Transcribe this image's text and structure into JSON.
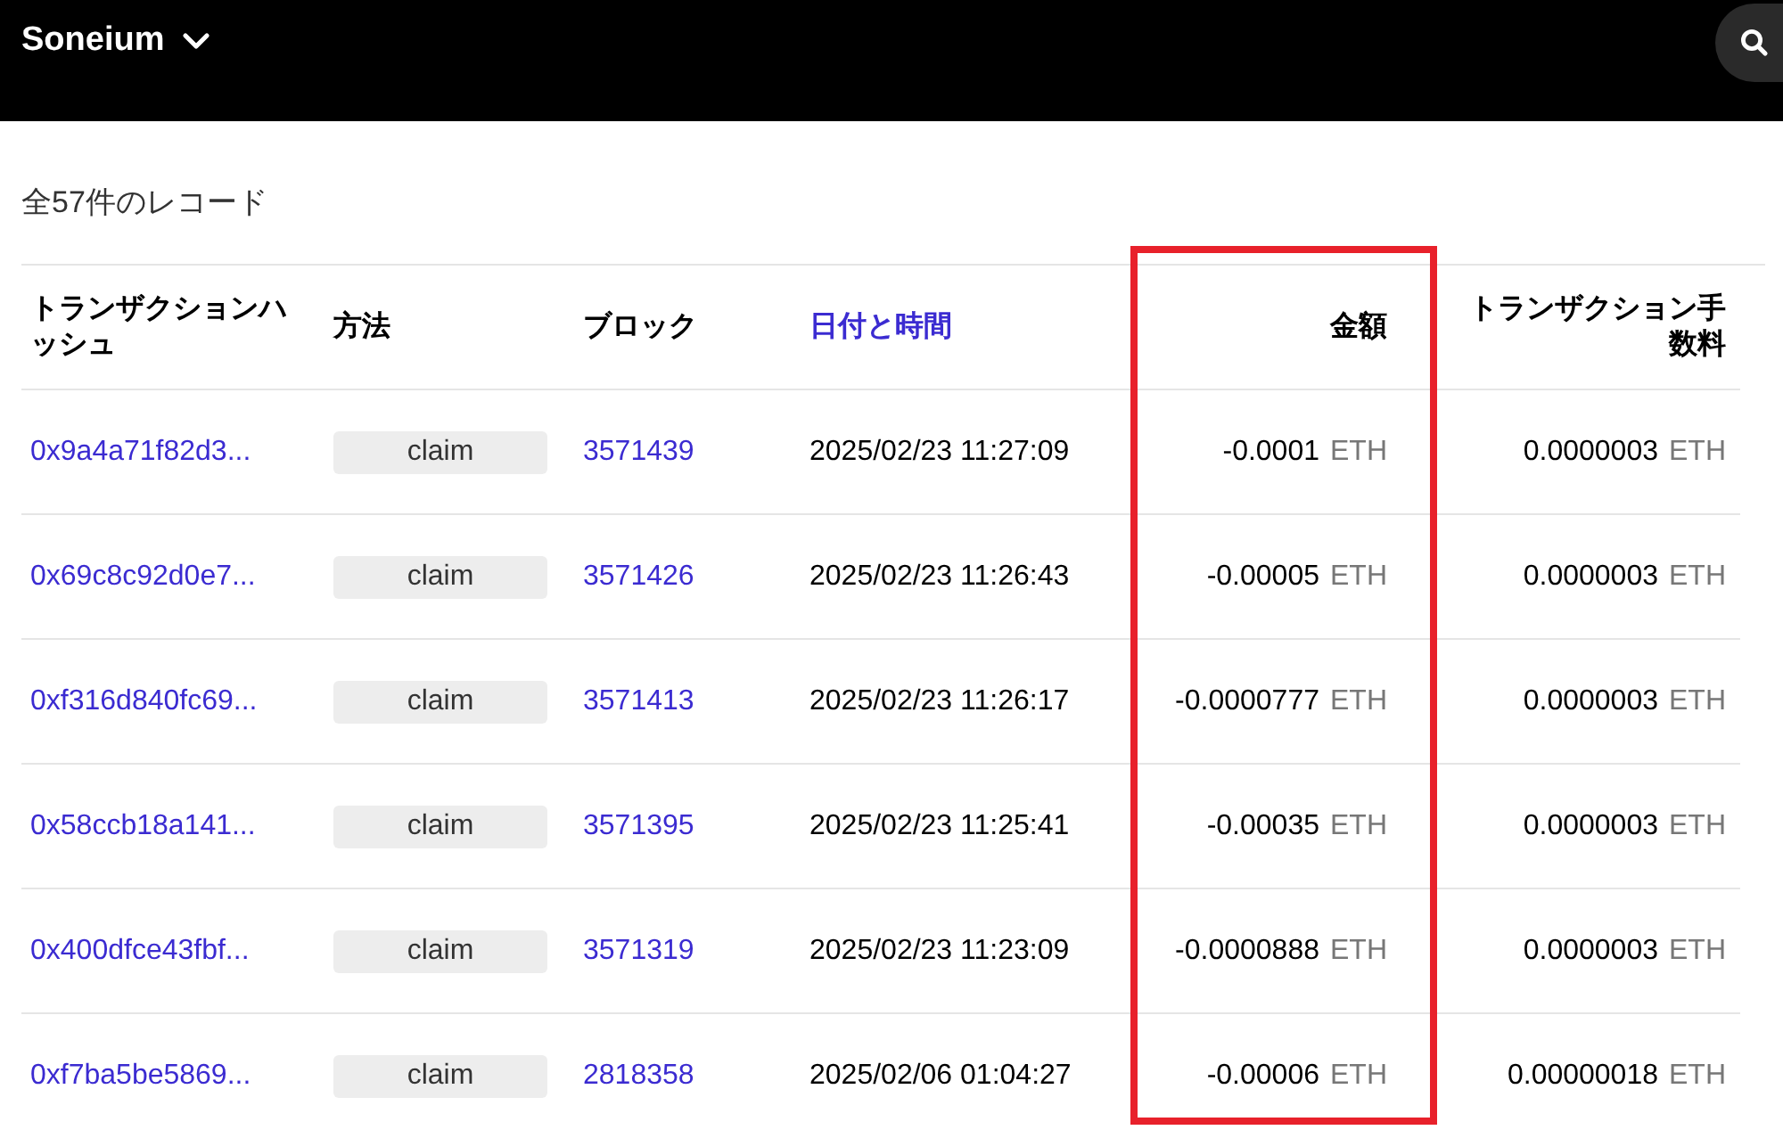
{
  "header": {
    "network": "Soneium"
  },
  "record_count": "全57件のレコード",
  "table": {
    "columns": [
      {
        "label": "トランザクションハッシュ",
        "kind": "plain",
        "highlighted": false
      },
      {
        "label": "方法",
        "kind": "plain",
        "highlighted": false
      },
      {
        "label": "ブロック",
        "kind": "plain",
        "highlighted": false
      },
      {
        "label": "日付と時間",
        "kind": "link",
        "highlighted": false
      },
      {
        "label": "金額",
        "kind": "plain",
        "highlighted": true
      },
      {
        "label": "トランザクション手数料",
        "kind": "plain",
        "highlighted": false
      }
    ],
    "rows": [
      {
        "hash": "0x9a4a71f82d3...",
        "method": "claim",
        "block": "3571439",
        "time": "2025/02/23 11:27:09",
        "amount": "-0.0001",
        "amount_unit": "ETH",
        "fee": "0.0000003",
        "fee_unit": "ETH"
      },
      {
        "hash": "0x69c8c92d0e7...",
        "method": "claim",
        "block": "3571426",
        "time": "2025/02/23 11:26:43",
        "amount": "-0.00005",
        "amount_unit": "ETH",
        "fee": "0.0000003",
        "fee_unit": "ETH"
      },
      {
        "hash": "0xf316d840fc69...",
        "method": "claim",
        "block": "3571413",
        "time": "2025/02/23 11:26:17",
        "amount": "-0.0000777",
        "amount_unit": "ETH",
        "fee": "0.0000003",
        "fee_unit": "ETH"
      },
      {
        "hash": "0x58ccb18a141...",
        "method": "claim",
        "block": "3571395",
        "time": "2025/02/23 11:25:41",
        "amount": "-0.00035",
        "amount_unit": "ETH",
        "fee": "0.0000003",
        "fee_unit": "ETH"
      },
      {
        "hash": "0x400dfce43fbf...",
        "method": "claim",
        "block": "3571319",
        "time": "2025/02/23 11:23:09",
        "amount": "-0.0000888",
        "amount_unit": "ETH",
        "fee": "0.0000003",
        "fee_unit": "ETH"
      },
      {
        "hash": "0xf7ba5be5869...",
        "method": "claim",
        "block": "2818358",
        "time": "2025/02/06 01:04:27",
        "amount": "-0.00006",
        "amount_unit": "ETH",
        "fee": "0.00000018",
        "fee_unit": "ETH"
      }
    ]
  }
}
